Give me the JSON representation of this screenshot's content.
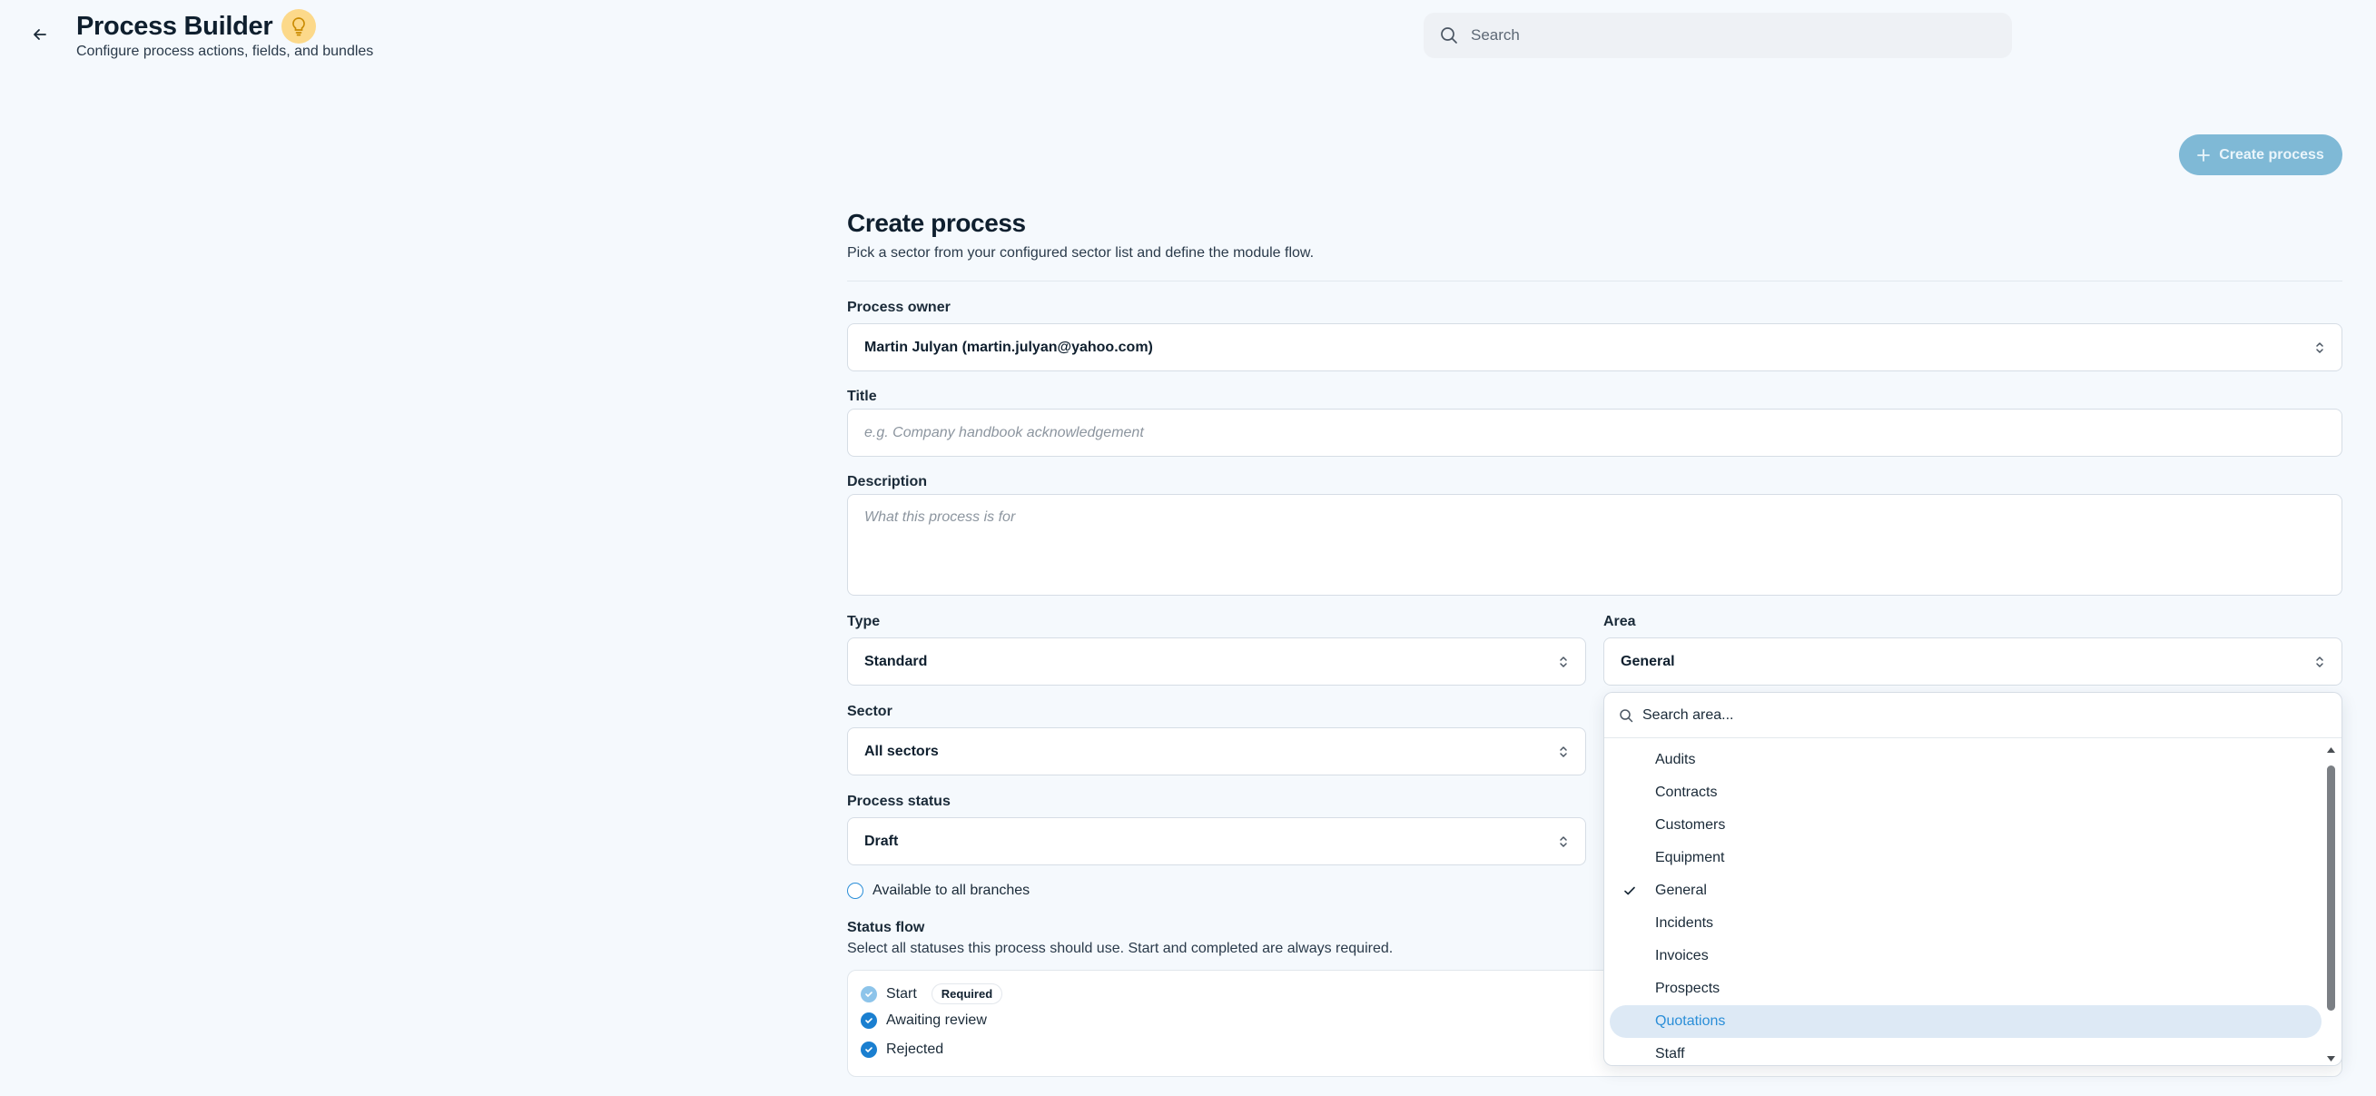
{
  "header": {
    "title": "Process Builder",
    "subtitle": "Configure process actions, fields, and bundles",
    "search_placeholder": "Search"
  },
  "actions": {
    "create_process": "Create process"
  },
  "form": {
    "title": "Create process",
    "subtitle": "Pick a sector from your configured sector list and define the module flow.",
    "process_owner": {
      "label": "Process owner",
      "value": "Martin Julyan (martin.julyan@yahoo.com)"
    },
    "title_field": {
      "label": "Title",
      "placeholder": "e.g. Company handbook acknowledgement"
    },
    "description": {
      "label": "Description",
      "placeholder": "What this process is for"
    },
    "type": {
      "label": "Type",
      "value": "Standard"
    },
    "area": {
      "label": "Area",
      "value": "General"
    },
    "sector": {
      "label": "Sector",
      "value": "All sectors"
    },
    "process_status": {
      "label": "Process status",
      "value": "Draft"
    },
    "branches_label": "Available to all branches",
    "status_flow": {
      "label": "Status flow",
      "hint": "Select all statuses this process should use. Start and completed are always required.",
      "items": [
        {
          "label": "Start",
          "badge": "Required"
        },
        {
          "label": "Awaiting review"
        },
        {
          "label": "Rejected"
        }
      ]
    }
  },
  "area_dropdown": {
    "search_placeholder": "Search area...",
    "selected": "General",
    "hovered": "Quotations",
    "options": [
      "Audits",
      "Contracts",
      "Customers",
      "Equipment",
      "General",
      "Incidents",
      "Invoices",
      "Prospects",
      "Quotations",
      "Staff"
    ]
  },
  "colors": {
    "accent": "#2a8ed8",
    "create_button": "#7fb9d6",
    "bulb": "#fcd98a"
  }
}
